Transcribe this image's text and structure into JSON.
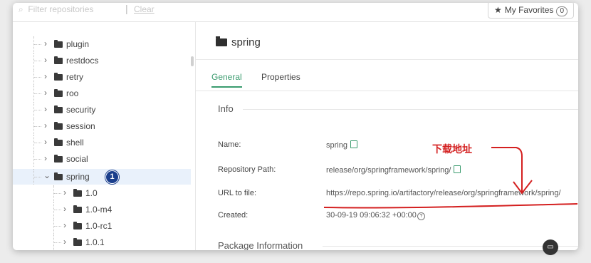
{
  "topbar": {
    "filter_placeholder": "Filter repositories",
    "clear_label": "Clear",
    "favorites_label": "My Favorites",
    "favorites_count": "0"
  },
  "tree": {
    "items": [
      {
        "label": "plugin"
      },
      {
        "label": "restdocs"
      },
      {
        "label": "retry"
      },
      {
        "label": "roo"
      },
      {
        "label": "security"
      },
      {
        "label": "session"
      },
      {
        "label": "shell"
      },
      {
        "label": "social"
      },
      {
        "label": "spring",
        "badge": "1"
      },
      {
        "label": "1.0"
      },
      {
        "label": "1.0-m4"
      },
      {
        "label": "1.0-rc1"
      },
      {
        "label": "1.0.1"
      }
    ]
  },
  "main": {
    "title": "spring",
    "tabs": [
      "General",
      "Properties"
    ],
    "info_heading": "Info",
    "rows": [
      {
        "label": "Name:",
        "value": "spring"
      },
      {
        "label": "Repository Path:",
        "value": "release/org/springframework/spring/"
      },
      {
        "label": "URL to file:",
        "value": "https://repo.spring.io/artifactory/release/org/springframework/spring/"
      },
      {
        "label": "Created:",
        "value": "30-09-19 09:06:32 +00:00"
      }
    ],
    "package_heading": "Package Information",
    "annotation": "下载地址"
  },
  "colors": {
    "accent": "#3a9b6e",
    "annotation": "#d42020",
    "badge": "#1a3e8c"
  }
}
